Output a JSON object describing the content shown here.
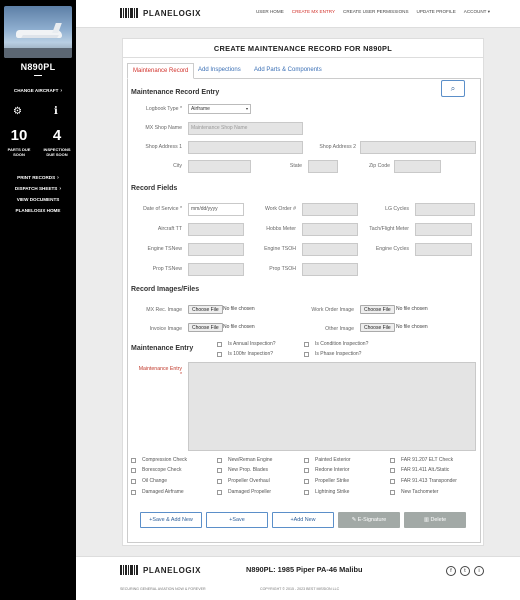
{
  "sidebar": {
    "tail_number": "N890PL",
    "change_aircraft": "Change Aircraft",
    "parts_count": "10",
    "parts_label": "Parts Due Soon",
    "inspections_count": "4",
    "inspections_label": "Inspections Due Soon",
    "print_records": "Print Records",
    "dispatch_sheets": "Dispatch Sheets",
    "view_documents": "View Documents",
    "home": "Planelogix Home"
  },
  "brand": {
    "name": "PLANELOGIX"
  },
  "topnav": {
    "user_home": "User Home",
    "create_mx": "Create MX Entry",
    "permissions": "Create User Permissions",
    "update_profile": "Update Profile",
    "account": "Account"
  },
  "page": {
    "title": "CREATE MAINTENANCE RECORD FOR N890PL",
    "tabs": [
      "Maintenance Record",
      "Add Inspections",
      "Add Parts & Components"
    ]
  },
  "entry": {
    "section_title": "Maintenance Record Entry",
    "logbook_label": "Logbook Type",
    "logbook_value": "Airframe",
    "shop_name_label": "MX Shop Name",
    "shop_name_placeholder": "Maintenance Shop Name",
    "addr1_label": "Shop Address 1",
    "addr2_label": "Shop Address 2",
    "city_label": "City",
    "state_label": "State",
    "zip_label": "Zip Code"
  },
  "fields": {
    "section_title": "Record Fields",
    "date_label": "Date of Service",
    "date_value": "mm/dd/yyyy",
    "work_order_label": "Work Order #",
    "lg_cycles_label": "LG Cycles",
    "aircraft_tt_label": "Aircraft TT",
    "hobbs_label": "Hobbs Meter",
    "tach_label": "Tach/Flight Meter",
    "engine_tsnew_label": "Engine TSNew",
    "engine_tsoh_label": "Engine TSOH",
    "engine_cycles_label": "Engine Cycles",
    "prop_tsnew_label": "Prop TSNew",
    "prop_tsoh_label": "Prop TSOH"
  },
  "files": {
    "section_title": "Record Images/Files",
    "mx_image_label": "MX Rec. Image",
    "work_order_image_label": "Work Order Image",
    "invoice_label": "Invoice Image",
    "other_label": "Other Image",
    "choose_label": "Choose File",
    "no_file": "No file chosen"
  },
  "mentry": {
    "section_title": "Maintenance Entry",
    "annual": "Is Annual Inspection?",
    "condition": "Is Condition Inspection?",
    "hundred": "Is 100hr Inspection?",
    "phase": "Is Phase Inspection?",
    "entry_label": "Maintenance Entry"
  },
  "checklist": [
    [
      "Compression Check",
      "New/Reman Engine",
      "Painted Exterior",
      "FAR 91.207 ELT Check"
    ],
    [
      "Borescope Check",
      "New Prop. Blades",
      "Redone Interior",
      "FAR 91.411 Alt./Static"
    ],
    [
      "Oil Change",
      "Propeller Overhaul",
      "Propeller Strike",
      "FAR 91.413 Transponder"
    ],
    [
      "Damaged Airframe",
      "Damaged Propeller",
      "Lightning Strike",
      "New Tachometer"
    ]
  ],
  "buttons": {
    "save_add_new": "Save & Add New",
    "save": "Save",
    "add_new": "Add New",
    "esignature": "E-Signature",
    "delete": "Delete"
  },
  "footer": {
    "title": "N890PL: 1985 Piper PA-46 Malibu",
    "tagline": "Securing general aviation now & forever",
    "copyright": "Copyright © 2015 - 2023 Best Mission LLC",
    "social": [
      "f",
      "t",
      "i"
    ]
  }
}
